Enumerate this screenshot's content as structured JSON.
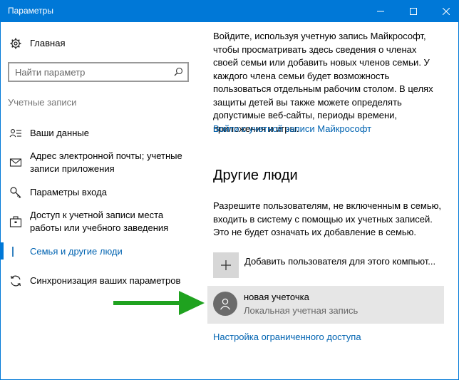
{
  "window": {
    "title": "Параметры",
    "accent": "#0078d7"
  },
  "titlebar_buttons": {
    "minimize_icon": "minimize-icon",
    "maximize_icon": "maximize-icon",
    "close_icon": "close-icon"
  },
  "sidebar": {
    "home_label": "Главная",
    "search_placeholder": "Найти параметр",
    "section_label": "Учетные записи",
    "items": [
      {
        "label": "Ваши данные",
        "icon": "person-card-icon"
      },
      {
        "label": "Адрес электронной почты; учетные записи приложения",
        "icon": "mail-icon"
      },
      {
        "label": "Параметры входа",
        "icon": "key-icon"
      },
      {
        "label": "Доступ к учетной записи места работы или учебного заведения",
        "icon": "briefcase-icon"
      },
      {
        "label": "Семья и другие люди",
        "icon": "people-icon",
        "active": true
      },
      {
        "label": "Синхронизация ваших параметров",
        "icon": "sync-icon"
      }
    ]
  },
  "main": {
    "intro": "Войдите, используя учетную запись Майкрософт, чтобы просматривать здесь сведения о членах своей семьи или добавить новых членов семьи. У каждого члена семьи будет возможность пользоваться отдельным рабочим столом. В целях защиты детей вы также можете определять допустимые веб-сайты, периоды времени, приложения и игры.",
    "signin_link": "Войти с учетной записи Майкрософт",
    "heading": "Другие люди",
    "description": "Разрешите пользователям, не включенным в семью, входить в систему с помощью их учетных записей. Это не будет означать их добавление в семью.",
    "add_user_label": "Добавить пользователя для этого компьют...",
    "account": {
      "name": "новая учеточка",
      "type": "Локальная учетная запись"
    },
    "restricted_link": "Настройка ограниченного доступа"
  },
  "colors": {
    "link": "#0063b1",
    "annotation_arrow": "#1fa21f"
  }
}
